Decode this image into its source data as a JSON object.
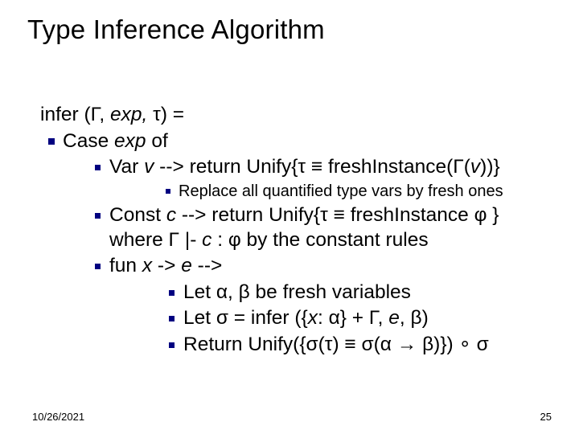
{
  "title": "Type Inference Algorithm",
  "line_infer": "infer (Γ, exp, τ) =",
  "case_of": "Case exp of",
  "var_line": "Var v --> return Unify{τ ≡ freshInstance(Γ(v))}",
  "replace_line": "Replace all quantified type vars by fresh ones",
  "const_line": "Const c --> return Unify{τ ≡ freshInstance φ }",
  "const_where": "where Γ |- c : φ by the constant rules",
  "fun_line": "fun x -> e -->",
  "let1": "Let α, β be fresh variables",
  "let2": "Let σ = infer ({x: α} + Γ, e, β)",
  "return_line": "Return Unify({σ(τ) ≡ σ(α → β)}) ∘ σ",
  "footer_date": "10/26/2021",
  "footer_page": "25"
}
